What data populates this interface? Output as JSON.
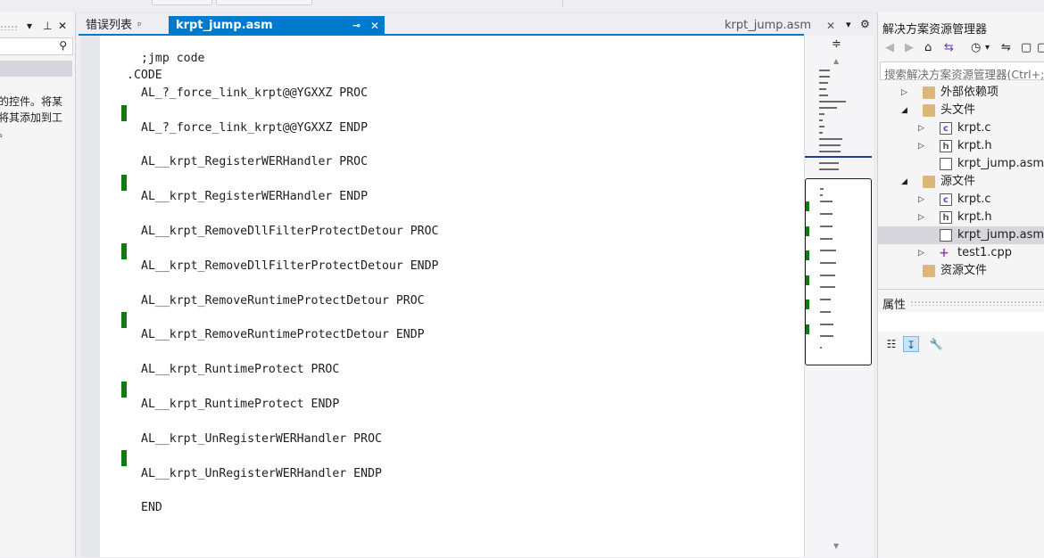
{
  "left_panel": {
    "message": "的控件。将某\n将其添加到工\n。",
    "search_icon": "search-icon",
    "search_glyph": "⚲",
    "dropdown_glyph": "▾",
    "pin_glyph": "⊥",
    "close_glyph": "✕"
  },
  "tabs": {
    "errors_label": "错误列表",
    "errors_pin": "ᵖ",
    "active_label": "krpt_jump.asm",
    "active_pin": "⊸",
    "active_close": "✕",
    "preview_label": "krpt_jump.asm",
    "preview_close": "✕",
    "overflow": "▾",
    "settings": "⚙"
  },
  "editor": {
    "lines": [
      ";jmp code",
      ".CODE",
      "AL_?_force_link_krpt@@YGXXZ PROC",
      "AL_?_force_link_krpt@@YGXXZ ENDP",
      "AL__krpt_RegisterWERHandler PROC",
      "AL__krpt_RegisterWERHandler ENDP",
      "AL__krpt_RemoveDllFilterProtectDetour PROC",
      "AL__krpt_RemoveDllFilterProtectDetour ENDP",
      "AL__krpt_RemoveRuntimeProtectDetour PROC",
      "AL__krpt_RemoveRuntimeProtectDetour ENDP",
      "AL__krpt_RuntimeProtect PROC",
      "AL__krpt_RuntimeProtect ENDP",
      "AL__krpt_UnRegisterWERHandler PROC",
      "AL__krpt_UnRegisterWERHandler ENDP",
      "END"
    ],
    "change_marker_color": "#107c10"
  },
  "minimap": {
    "split_glyph": "≑",
    "up_arrow": "▲",
    "down_arrow": "▼"
  },
  "solution_explorer": {
    "title": "解决方案资源管理器",
    "search_placeholder": "搜索解决方案资源管理器(Ctrl+;)",
    "toolbar": [
      "◀",
      "▶",
      "⌂",
      "⇆",
      "◷",
      "▾",
      "⇋",
      "▢",
      "▢"
    ],
    "tree": [
      {
        "label": "外部依赖项",
        "icon": "folder-ref",
        "expander": "▷",
        "level": 1
      },
      {
        "label": "头文件",
        "icon": "folder",
        "expander": "◢",
        "level": 1
      },
      {
        "label": "krpt.c",
        "icon": "c-file",
        "glyph": "c",
        "expander": "▷",
        "level": 2
      },
      {
        "label": "krpt.h",
        "icon": "h-file",
        "glyph": "h",
        "expander": "▷",
        "level": 2
      },
      {
        "label": "krpt_jump.asm",
        "icon": "asm-file",
        "glyph": "",
        "expander": "",
        "level": 2
      },
      {
        "label": "源文件",
        "icon": "folder",
        "expander": "◢",
        "level": 1
      },
      {
        "label": "krpt.c",
        "icon": "c-file",
        "glyph": "c",
        "expander": "▷",
        "level": 2
      },
      {
        "label": "krpt.h",
        "icon": "h-file",
        "glyph": "h",
        "expander": "▷",
        "level": 2
      },
      {
        "label": "krpt_jump.asm",
        "icon": "asm-file",
        "glyph": "",
        "expander": "",
        "level": 2,
        "selected": true
      },
      {
        "label": "test1.cpp",
        "icon": "cpp-file",
        "glyph": "+",
        "expander": "▷",
        "level": 2
      },
      {
        "label": "资源文件",
        "icon": "folder",
        "expander": "",
        "level": 1
      }
    ]
  },
  "properties": {
    "title": "属性",
    "toolbar": [
      "☷",
      "↧",
      "🔧"
    ]
  },
  "accent_color": "#007acc"
}
